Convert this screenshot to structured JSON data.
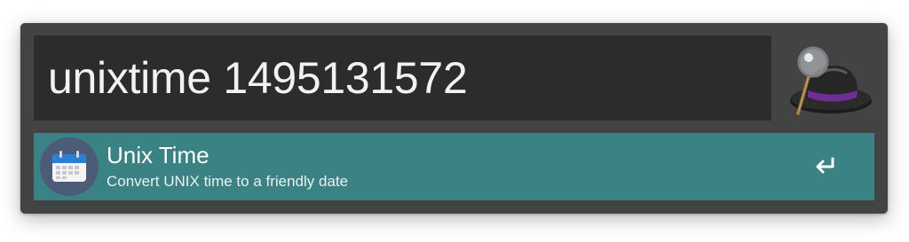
{
  "search": {
    "query": "unixtime 1495131572"
  },
  "app_icon": "alfred-hat-icon",
  "results": [
    {
      "title": "Unix Time",
      "subtitle": "Convert UNIX time to a friendly date",
      "icon": "calendar-icon",
      "action_icon": "return-key-icon",
      "selected": true
    }
  ],
  "colors": {
    "window_background": "#434343",
    "search_background": "#2c2c2c",
    "selected_result_background": "#3a8283",
    "result_icon_background": "#4c5c78",
    "text_primary": "#ffffff"
  }
}
